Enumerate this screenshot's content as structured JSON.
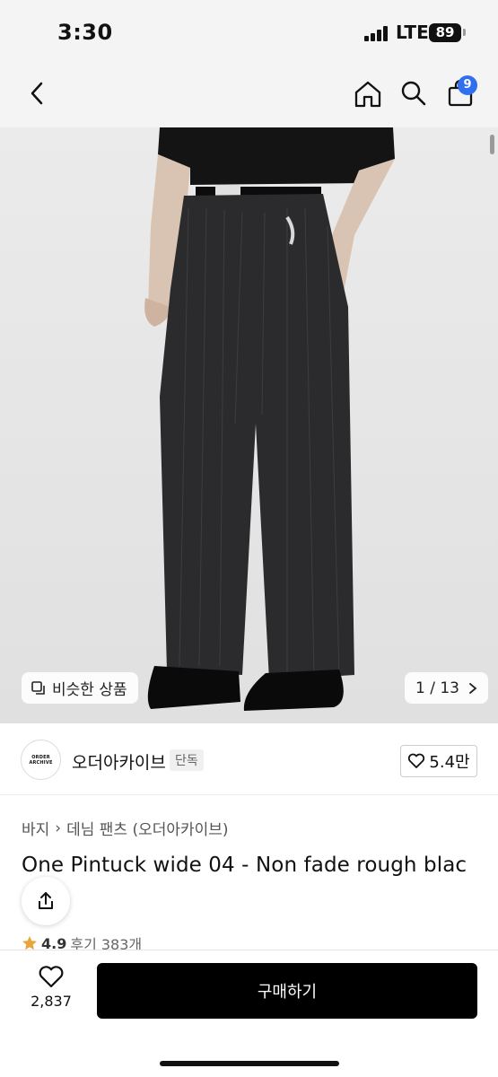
{
  "status_bar": {
    "time": "3:30",
    "network": "LTE",
    "battery": "89"
  },
  "nav": {
    "cart_count": "9",
    "icons": [
      "back-icon",
      "home-icon",
      "search-icon",
      "shopping-bag-icon"
    ]
  },
  "hero": {
    "similar_label": "비슷한 상품",
    "image_counter": "1 / 13"
  },
  "brand": {
    "logo_line1": "ORDER",
    "logo_line2": "ARCHIVE",
    "name": "오더아카이브",
    "tag": "단독",
    "likes": "5.4만"
  },
  "product": {
    "breadcrumb": [
      "바지",
      "데님 팬츠 (오더아카이브)"
    ],
    "title": "One Pintuck wide 04 - Non fade rough blac",
    "rating": "4.9",
    "reviews": "후기 383개"
  },
  "bottom_bar": {
    "wish_count": "2,837",
    "buy_label": "구매하기"
  },
  "colors": {
    "accent": "#2f6ff0",
    "star": "#e8a53b",
    "buy_bg": "#000000"
  }
}
